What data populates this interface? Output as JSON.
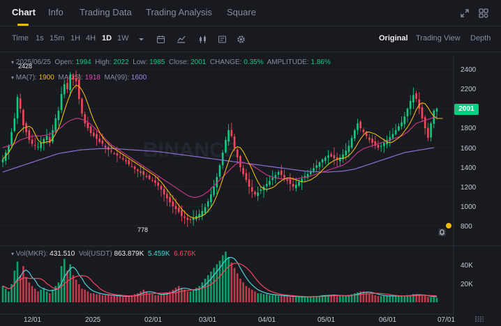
{
  "tabs": [
    {
      "label": "Chart",
      "active": true
    },
    {
      "label": "Info",
      "active": false
    },
    {
      "label": "Trading Data",
      "active": false
    },
    {
      "label": "Trading Analysis",
      "active": false
    },
    {
      "label": "Square",
      "active": false
    }
  ],
  "top_icons": [
    "fullscreen-icon",
    "settings-grid-icon"
  ],
  "toolbar": {
    "time_label": "Time",
    "intervals": [
      "1s",
      "15m",
      "1H",
      "4H",
      "1D",
      "1W"
    ],
    "active_interval": "1D",
    "icons": [
      "dropdown-caret-icon",
      "calendar-icon",
      "indicator-icon",
      "candle-type-icon",
      "layout-icon",
      "gear-icon"
    ]
  },
  "views": [
    {
      "label": "Original",
      "active": true
    },
    {
      "label": "Trading View",
      "active": false
    },
    {
      "label": "Depth",
      "active": false
    }
  ],
  "ohlc": {
    "date": "2025/06/25",
    "open_label": "Open:",
    "open": "1994",
    "high_label": "High:",
    "high": "2022",
    "low_label": "Low:",
    "low": "1985",
    "close_label": "Close:",
    "close": "2001",
    "change_label": "CHANGE:",
    "change": "0.35%",
    "amplitude_label": "AMPLITUDE:",
    "amplitude": "1.86%"
  },
  "ma": {
    "ma7_label": "MA(7):",
    "ma7": "1900",
    "ma25_label": "MA(25):",
    "ma25": "1918",
    "ma99_label": "MA(99):",
    "ma99": "1600"
  },
  "volume": {
    "label": "Vol(MKR):",
    "value": "431.510",
    "usdt_label": "Vol(USDT)",
    "usdt": "863.879K",
    "ma1": "5.459K",
    "ma2": "6.676K"
  },
  "price_axis": [
    "2400",
    "2200",
    "2000",
    "1800",
    "1600",
    "1400",
    "1200",
    "1000",
    "800"
  ],
  "volume_axis": [
    "40K",
    "20K"
  ],
  "time_axis": [
    "12/01",
    "2025",
    "02/01",
    "03/01",
    "04/01",
    "05/01",
    "06/01",
    "07/01"
  ],
  "current_price": "2001",
  "annotations": {
    "high": "2428",
    "low": "778"
  },
  "watermark": "BINANCE",
  "colors": {
    "up": "#0ecb81",
    "down": "#f6465d",
    "ma7": "#f0b90b",
    "ma25": "#c13584",
    "ma99": "#8d6fd6",
    "accent": "#f0b90b"
  },
  "chart_data": {
    "type": "candlestick",
    "interval": "1D",
    "x": [
      "12/01",
      "2025",
      "02/01",
      "03/01",
      "04/01",
      "05/01",
      "06/01",
      "07/01"
    ],
    "close": [
      1480,
      1550,
      1620,
      1760,
      1900,
      2120,
      2000,
      1830,
      1760,
      1680,
      1640,
      1620,
      1610,
      1650,
      1690,
      1720,
      1650,
      1780,
      1900,
      1980,
      2150,
      2250,
      2200,
      2350,
      2300,
      2280,
      2100,
      1950,
      1850,
      1800,
      1750,
      1720,
      1690,
      1660,
      1640,
      1600,
      1580,
      1560,
      1540,
      1520,
      1500,
      1480,
      1460,
      1430,
      1410,
      1380,
      1360,
      1340,
      1320,
      1300,
      1280,
      1260,
      1240,
      1210,
      1170,
      1120,
      1080,
      1040,
      1000,
      970,
      940,
      900,
      880,
      860,
      860,
      880,
      900,
      920,
      950,
      990,
      1050,
      1120,
      1200,
      1300,
      1420,
      1550,
      1680,
      1780,
      1720,
      1600,
      1500,
      1400,
      1330,
      1270,
      1200,
      1150,
      1120,
      1140,
      1170,
      1200,
      1230,
      1260,
      1290,
      1320,
      1350,
      1320,
      1290,
      1260,
      1230,
      1200,
      1220,
      1250,
      1280,
      1310,
      1330,
      1360,
      1390,
      1420,
      1450,
      1480,
      1500,
      1520,
      1510,
      1490,
      1480,
      1500,
      1530,
      1570,
      1620,
      1700,
      1780,
      1850,
      1800,
      1760,
      1720,
      1680,
      1650,
      1620,
      1600,
      1620,
      1650,
      1680,
      1710,
      1740,
      1780,
      1820,
      1860,
      1920,
      2000,
      2080,
      2140,
      2100,
      2000,
      1900,
      1800,
      1700,
      1850,
      1980,
      2001
    ],
    "ma7": [
      1480,
      1515,
      1550,
      1600,
      1660,
      1740,
      1770,
      1800,
      1810,
      1820,
      1800,
      1740,
      1680,
      1650,
      1650,
      1660,
      1660,
      1690,
      1740,
      1800,
      1880,
      1980,
      2070,
      2150,
      2210,
      2240,
      2230,
      2190,
      2130,
      2050,
      1960,
      1880,
      1820,
      1760,
      1710,
      1670,
      1640,
      1610,
      1590,
      1570,
      1550,
      1530,
      1510,
      1490,
      1470,
      1450,
      1430,
      1410,
      1390,
      1370,
      1350,
      1330,
      1310,
      1280,
      1250,
      1210,
      1170,
      1130,
      1090,
      1050,
      1010,
      970,
      940,
      910,
      890,
      880,
      880,
      890,
      900,
      920,
      950,
      990,
      1040,
      1110,
      1190,
      1280,
      1370,
      1460,
      1540,
      1590,
      1610,
      1600,
      1560,
      1500,
      1440,
      1380,
      1310,
      1250,
      1200,
      1180,
      1170,
      1180,
      1190,
      1210,
      1240,
      1260,
      1280,
      1290,
      1290,
      1280,
      1270,
      1260,
      1250,
      1250,
      1260,
      1270,
      1290,
      1310,
      1340,
      1370,
      1400,
      1430,
      1450,
      1470,
      1480,
      1490,
      1490,
      1500,
      1520,
      1550,
      1590,
      1640,
      1690,
      1730,
      1760,
      1760,
      1750,
      1740,
      1720,
      1700,
      1680,
      1660,
      1650,
      1660,
      1680,
      1700,
      1730,
      1770,
      1810,
      1860,
      1920,
      1990,
      2040,
      2060,
      2050,
      2010,
      1960,
      1920,
      1900,
      1900,
      1900
    ],
    "ma25": [
      1600,
      1610,
      1620,
      1630,
      1640,
      1660,
      1680,
      1690,
      1700,
      1710,
      1715,
      1720,
      1720,
      1720,
      1725,
      1730,
      1740,
      1750,
      1770,
      1790,
      1810,
      1840,
      1860,
      1880,
      1890,
      1900,
      1900,
      1890,
      1880,
      1860,
      1840,
      1810,
      1780,
      1750,
      1720,
      1690,
      1660,
      1630,
      1610,
      1590,
      1570,
      1550,
      1530,
      1510,
      1490,
      1470,
      1450,
      1430,
      1410,
      1390,
      1370,
      1350,
      1330,
      1310,
      1290,
      1270,
      1250,
      1230,
      1210,
      1190,
      1170,
      1150,
      1130,
      1110,
      1100,
      1090,
      1090,
      1100,
      1110,
      1130,
      1150,
      1180,
      1210,
      1240,
      1270,
      1300,
      1330,
      1360,
      1390,
      1420,
      1440,
      1450,
      1450,
      1440,
      1430,
      1420,
      1400,
      1380,
      1360,
      1340,
      1320,
      1310,
      1300,
      1290,
      1285,
      1280,
      1280,
      1280,
      1280,
      1280,
      1280,
      1285,
      1290,
      1295,
      1300,
      1310,
      1320,
      1330,
      1340,
      1350,
      1360,
      1370,
      1380,
      1390,
      1400,
      1410,
      1420,
      1440,
      1460,
      1490,
      1520,
      1550,
      1570,
      1590,
      1600,
      1610,
      1620,
      1630,
      1640,
      1650,
      1660,
      1670,
      1680,
      1690,
      1700,
      1710,
      1720,
      1740,
      1760,
      1790,
      1820,
      1850,
      1860,
      1870,
      1880,
      1890,
      1900,
      1910,
      1918
    ],
    "ma99": [
      1350,
      1360,
      1370,
      1380,
      1390,
      1400,
      1410,
      1420,
      1430,
      1440,
      1450,
      1460,
      1470,
      1480,
      1490,
      1500,
      1510,
      1520,
      1530,
      1540,
      1545,
      1550,
      1555,
      1560,
      1565,
      1570,
      1575,
      1578,
      1580,
      1582,
      1584,
      1586,
      1588,
      1590,
      1590,
      1590,
      1590,
      1590,
      1590,
      1588,
      1586,
      1584,
      1582,
      1580,
      1578,
      1576,
      1574,
      1572,
      1570,
      1568,
      1566,
      1564,
      1562,
      1560,
      1556,
      1552,
      1548,
      1544,
      1540,
      1536,
      1532,
      1528,
      1524,
      1520,
      1516,
      1512,
      1508,
      1504,
      1500,
      1496,
      1492,
      1488,
      1484,
      1480,
      1476,
      1472,
      1468,
      1464,
      1460,
      1456,
      1452,
      1448,
      1444,
      1440,
      1436,
      1432,
      1428,
      1424,
      1420,
      1416,
      1412,
      1408,
      1404,
      1400,
      1396,
      1392,
      1388,
      1384,
      1380,
      1376,
      1372,
      1368,
      1364,
      1360,
      1358,
      1356,
      1354,
      1352,
      1350,
      1350,
      1350,
      1350,
      1352,
      1354,
      1356,
      1358,
      1360,
      1365,
      1370,
      1375,
      1380,
      1390,
      1400,
      1410,
      1420,
      1430,
      1440,
      1450,
      1460,
      1470,
      1480,
      1490,
      1500,
      1510,
      1520,
      1530,
      1540,
      1550,
      1555,
      1560,
      1565,
      1570,
      1575,
      1580,
      1585,
      1590,
      1595,
      1600
    ],
    "volume_k": [
      18,
      15,
      12,
      20,
      35,
      45,
      30,
      40,
      28,
      22,
      18,
      15,
      12,
      14,
      16,
      12,
      10,
      14,
      18,
      22,
      40,
      48,
      35,
      42,
      30,
      25,
      20,
      15,
      14,
      12,
      10,
      10,
      9,
      9,
      8,
      8,
      8,
      7,
      7,
      7,
      7,
      6,
      6,
      7,
      8,
      9,
      10,
      12,
      14,
      12,
      10,
      9,
      8,
      8,
      9,
      10,
      11,
      12,
      14,
      16,
      18,
      16,
      14,
      12,
      12,
      14,
      16,
      18,
      22,
      26,
      30,
      34,
      38,
      42,
      46,
      52,
      56,
      50,
      44,
      38,
      32,
      26,
      22,
      18,
      16,
      14,
      12,
      10,
      10,
      9,
      9,
      8,
      8,
      8,
      7,
      7,
      7,
      7,
      6,
      6,
      6,
      6,
      6,
      6,
      6,
      6,
      7,
      7,
      7,
      8,
      8,
      8,
      8,
      8,
      7,
      7,
      7,
      7,
      8,
      9,
      10,
      11,
      12,
      12,
      11,
      10,
      9,
      8,
      7,
      7,
      7,
      7,
      7,
      7,
      7,
      7,
      7,
      7,
      8,
      8,
      9,
      9,
      8,
      7,
      7,
      6,
      6,
      6,
      5
    ],
    "ylim": [
      700,
      2500
    ],
    "high_marker": 2428,
    "low_marker": 778
  }
}
